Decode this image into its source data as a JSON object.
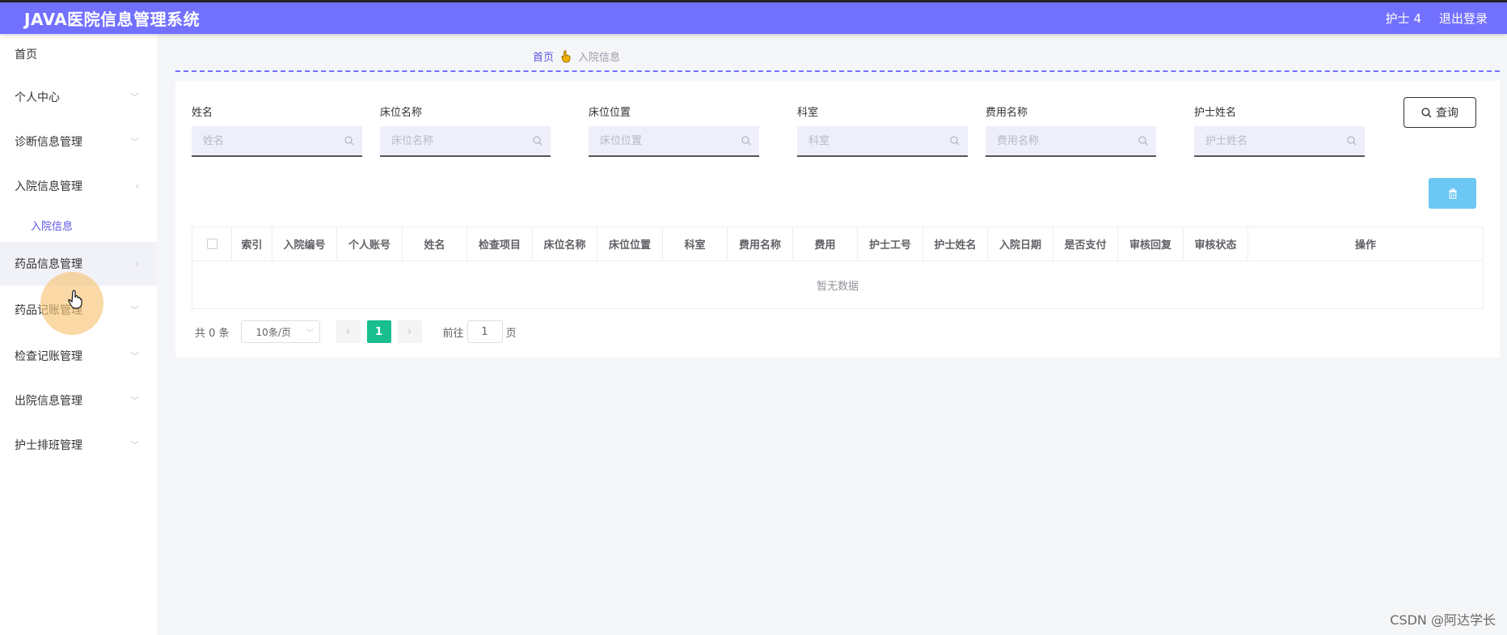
{
  "header": {
    "title": "JAVA医院信息管理系统",
    "user": "护士 4",
    "logout": "退出登录"
  },
  "sidebar": {
    "items": [
      {
        "label": "首页",
        "chevron": ""
      },
      {
        "label": "个人中心",
        "chevron": "﹀"
      },
      {
        "label": "诊断信息管理",
        "chevron": "﹀"
      },
      {
        "label": "入院信息管理",
        "chevron": "‹"
      },
      {
        "label": "药品信息管理",
        "chevron": "‹"
      },
      {
        "label": "药品记账管理",
        "chevron": "﹀"
      },
      {
        "label": "检查记账管理",
        "chevron": "﹀"
      },
      {
        "label": "出院信息管理",
        "chevron": "﹀"
      },
      {
        "label": "护士排班管理",
        "chevron": "﹀"
      }
    ],
    "submenu_label": "入院信息"
  },
  "breadcrumb": {
    "home": "首页",
    "current": "入院信息"
  },
  "filters": [
    {
      "label": "姓名",
      "placeholder": "姓名"
    },
    {
      "label": "床位名称",
      "placeholder": "床位名称"
    },
    {
      "label": "床位位置",
      "placeholder": "床位位置"
    },
    {
      "label": "科室",
      "placeholder": "科室"
    },
    {
      "label": "费用名称",
      "placeholder": "费用名称"
    },
    {
      "label": "护士姓名",
      "placeholder": "护士姓名"
    }
  ],
  "buttons": {
    "query": "查询"
  },
  "table": {
    "columns": [
      "索引",
      "入院编号",
      "个人账号",
      "姓名",
      "检查项目",
      "床位名称",
      "床位位置",
      "科室",
      "费用名称",
      "费用",
      "护士工号",
      "护士姓名",
      "入院日期",
      "是否支付",
      "审核回复",
      "审核状态",
      "操作"
    ],
    "empty_text": "暂无数据"
  },
  "pagination": {
    "total": "共 0 条",
    "page_size": "10条/页",
    "current_page": "1",
    "goto_label": "前往",
    "goto_value": "1",
    "page_suffix": "页"
  },
  "watermark": "CSDN @阿达学长",
  "colors": {
    "header_bg": "#7270ff",
    "accent": "#5b55e0",
    "active_page": "#19be8f",
    "delete_button": "#6cc7f5"
  }
}
